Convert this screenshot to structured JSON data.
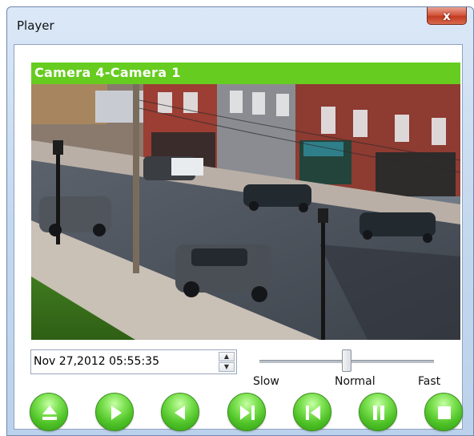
{
  "window": {
    "title": "Player",
    "close_label": "x"
  },
  "camera": {
    "title": "Camera 4-Camera 1"
  },
  "playback": {
    "datetime": "Nov 27,2012 05:55:35",
    "spin_up": "▲",
    "spin_down": "▼"
  },
  "speed": {
    "labels": {
      "slow": "Slow",
      "normal": "Normal",
      "fast": "Fast"
    },
    "value": 0.5
  },
  "controls": [
    {
      "name": "eject-button",
      "icon": "eject-icon"
    },
    {
      "name": "play-button",
      "icon": "play-icon"
    },
    {
      "name": "reverse-play-button",
      "icon": "reverse-play-icon"
    },
    {
      "name": "next-frame-button",
      "icon": "step-forward-icon"
    },
    {
      "name": "previous-frame-button",
      "icon": "step-backward-icon"
    },
    {
      "name": "pause-button",
      "icon": "pause-icon"
    },
    {
      "name": "stop-button",
      "icon": "stop-icon"
    }
  ],
  "colors": {
    "header_green": "#66cc1f",
    "button_green": "#4fc227"
  }
}
